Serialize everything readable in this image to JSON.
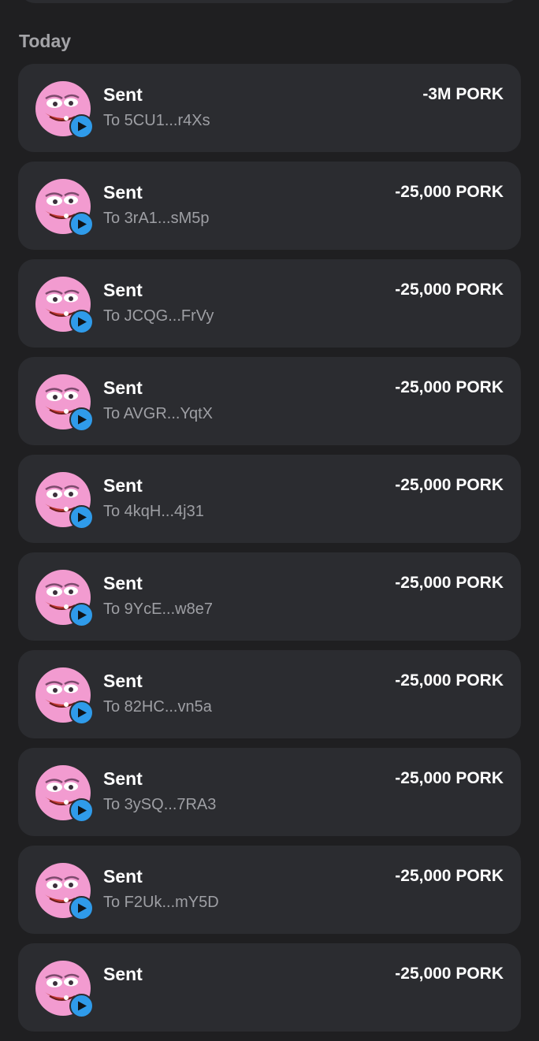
{
  "section": {
    "title": "Today"
  },
  "transactions": [
    {
      "title": "Sent",
      "address": "To 5CU1...r4Xs",
      "amount": "-3M PORK"
    },
    {
      "title": "Sent",
      "address": "To 3rA1...sM5p",
      "amount": "-25,000 PORK"
    },
    {
      "title": "Sent",
      "address": "To JCQG...FrVy",
      "amount": "-25,000 PORK"
    },
    {
      "title": "Sent",
      "address": "To AVGR...YqtX",
      "amount": "-25,000 PORK"
    },
    {
      "title": "Sent",
      "address": "To 4kqH...4j31",
      "amount": "-25,000 PORK"
    },
    {
      "title": "Sent",
      "address": "To 9YcE...w8e7",
      "amount": "-25,000 PORK"
    },
    {
      "title": "Sent",
      "address": "To 82HC...vn5a",
      "amount": "-25,000 PORK"
    },
    {
      "title": "Sent",
      "address": "To 3ySQ...7RA3",
      "amount": "-25,000 PORK"
    },
    {
      "title": "Sent",
      "address": "To F2Uk...mY5D",
      "amount": "-25,000 PORK"
    },
    {
      "title": "Sent",
      "address": "",
      "amount": "-25,000 PORK"
    }
  ],
  "icons": {
    "token": "pork-token-icon",
    "badge": "send-arrow-icon"
  },
  "colors": {
    "background": "#1f1f21",
    "card": "#2b2c30",
    "badge": "#2f9bea",
    "token_pink": "#f29bd0"
  }
}
